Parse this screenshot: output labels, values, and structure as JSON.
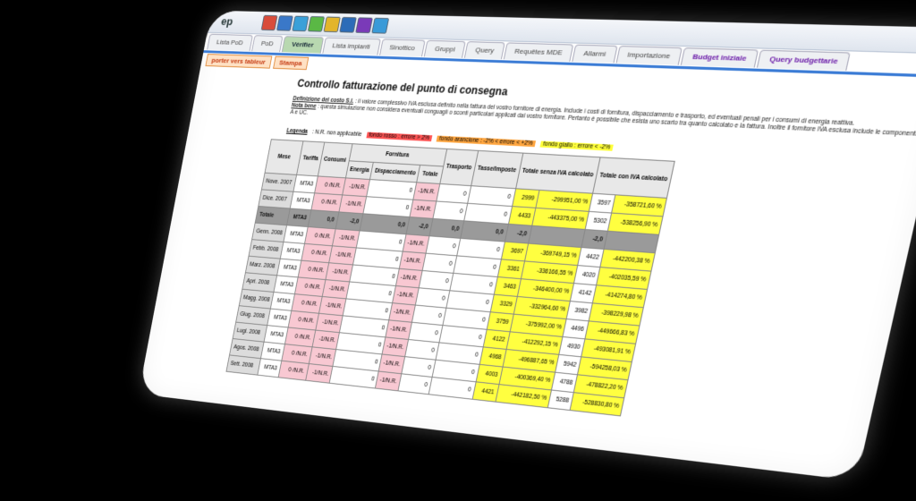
{
  "app": {
    "name": "ep"
  },
  "toolbar_icons": [
    {
      "name": "icon-1",
      "color": "#d94c3a"
    },
    {
      "name": "icon-2",
      "color": "#3a78c8"
    },
    {
      "name": "icon-3",
      "color": "#3aa0d8"
    },
    {
      "name": "icon-4",
      "color": "#5ab845"
    },
    {
      "name": "icon-5",
      "color": "#e3b52a"
    },
    {
      "name": "icon-6",
      "color": "#2c6cb8"
    },
    {
      "name": "icon-7",
      "color": "#7a3ab8"
    },
    {
      "name": "icon-8",
      "color": "#3a9ad8"
    }
  ],
  "tabs": [
    {
      "label": "Lista PoD",
      "style": ""
    },
    {
      "label": "PoD",
      "style": ""
    },
    {
      "label": "Vérifier",
      "style": "active"
    },
    {
      "label": "Lista impianti",
      "style": ""
    },
    {
      "label": "Sinottico",
      "style": ""
    },
    {
      "label": "Gruppi",
      "style": ""
    },
    {
      "label": "Query",
      "style": ""
    },
    {
      "label": "Requêtes MDE",
      "style": ""
    },
    {
      "label": "Allarmi",
      "style": ""
    },
    {
      "label": "Importazione",
      "style": ""
    },
    {
      "label": "Budget iniziale",
      "style": "purple"
    },
    {
      "label": "Query budgettarie",
      "style": "purple"
    }
  ],
  "subtabs": {
    "export": "porter vers tableur",
    "print": "Stampa"
  },
  "page_title": "Controllo fatturazione del punto di consegna",
  "notes": {
    "def_label": "Definizione del costo S.I.",
    "def_text": ": il valore complessivo IVA esclusa definito nella fattura del vostro fornitore di energia. Include i costi di fornitura, dispacciamento e trasporto, ed eventuali penali per i consumi di energia reattiva.",
    "nb_label": "Nota bene",
    "nb_text": ": questa simulazione non considera eventuali conguagli o sconti particolari applicati dal vostro fornitore. Pertanto è possibile che esista uno scarto tra quanto calcolato e la fattura. Inoltre il fornitore IVA esclusa include le componenti A e UC."
  },
  "legend": {
    "label": "Legenda",
    "nr": ": N.R. non applicabile",
    "red": "fondo rosso : errore > 2%",
    "orange": "fondo arancione : -2% < errore < +2%",
    "yellow": "fondo giallo : errore < -2%"
  },
  "table": {
    "headers": {
      "mese": "Mese",
      "tariffa": "Tariffa",
      "consumi": "Consumi",
      "fornitura": "Fornitura",
      "energia": "Energia",
      "dispacciamento": "Dispacciamento",
      "totale": "Totale",
      "trasporto": "Trasporto",
      "tasse": "Tasse/Imposte",
      "senza_iva": "Totale senza IVA calcolato",
      "con_iva": "Totale con IVA calcolato"
    },
    "rows": [
      {
        "mese": "Nove. 2007",
        "tariffa": "MTA3",
        "consumi": "0 /N.R.",
        "energia": "-1/N.R.",
        "disp": "0",
        "totale": "-1/N.R.",
        "trasporto": "0",
        "tasse": "0",
        "senza_iva": "2999",
        "senza_pct": "-299951,00 %",
        "con_iva": "3597",
        "con_pct": "-358721,60 %"
      },
      {
        "mese": "Dice. 2007",
        "tariffa": "MTA3",
        "consumi": "0 /N.R.",
        "energia": "-1/N.R.",
        "disp": "0",
        "totale": "-1/N.R.",
        "trasporto": "0",
        "tasse": "0",
        "senza_iva": "4433",
        "senza_pct": "-443375,00 %",
        "con_iva": "5302",
        "con_pct": "-538256,90 %"
      },
      {
        "mese": "Totale",
        "tariffa": "MTA3",
        "consumi": "0,0",
        "energia": "-2,0",
        "disp": "0,0",
        "totale": "-2,0",
        "trasporto": "0,0",
        "tasse": "0,0",
        "senza_iva": "-2,0",
        "senza_pct": "",
        "con_iva": "-2,0",
        "con_pct": "",
        "total": true
      },
      {
        "mese": "Genn. 2008",
        "tariffa": "MTA3",
        "consumi": "0 /N.R.",
        "energia": "-1/N.R.",
        "disp": "0",
        "totale": "-1/N.R.",
        "trasporto": "0",
        "tasse": "0",
        "senza_iva": "3697",
        "senza_pct": "-369749,15 %",
        "con_iva": "4422",
        "con_pct": "-442200,38 %"
      },
      {
        "mese": "Febb. 2008",
        "tariffa": "MTA3",
        "consumi": "0 /N.R.",
        "energia": "-1/N.R.",
        "disp": "0",
        "totale": "-1/N.R.",
        "trasporto": "0",
        "tasse": "0",
        "senza_iva": "3361",
        "senza_pct": "-336166,55 %",
        "con_iva": "4020",
        "con_pct": "-402035,59 %"
      },
      {
        "mese": "Marz. 2008",
        "tariffa": "MTA3",
        "consumi": "0 /N.R.",
        "energia": "-1/N.R.",
        "disp": "0",
        "totale": "-1/N.R.",
        "trasporto": "0",
        "tasse": "0",
        "senza_iva": "3463",
        "senza_pct": "-346400,00 %",
        "con_iva": "4142",
        "con_pct": "-414274,80 %"
      },
      {
        "mese": "Apri. 2008",
        "tariffa": "MTA3",
        "consumi": "0 /N.R.",
        "energia": "-1/N.R.",
        "disp": "0",
        "totale": "-1/N.R.",
        "trasporto": "0",
        "tasse": "0",
        "senza_iva": "3329",
        "senza_pct": "-332964,60 %",
        "con_iva": "3982",
        "con_pct": "-398229,98 %"
      },
      {
        "mese": "Magg. 2008",
        "tariffa": "MTA3",
        "consumi": "0 /N.R.",
        "energia": "-1/N.R.",
        "disp": "0",
        "totale": "-1/N.R.",
        "trasporto": "0",
        "tasse": "0",
        "senza_iva": "3759",
        "senza_pct": "-375992,00 %",
        "con_iva": "4496",
        "con_pct": "-449666,83 %"
      },
      {
        "mese": "Giug. 2008",
        "tariffa": "MTA3",
        "consumi": "0 /N.R.",
        "energia": "-1/N.R.",
        "disp": "0",
        "totale": "-1/N.R.",
        "trasporto": "0",
        "tasse": "0",
        "senza_iva": "4122",
        "senza_pct": "-412292,15 %",
        "con_iva": "4930",
        "con_pct": "-493081,91 %"
      },
      {
        "mese": "Lugl. 2008",
        "tariffa": "MTA3",
        "consumi": "0 /N.R.",
        "energia": "-1/N.R.",
        "disp": "0",
        "totale": "-1/N.R.",
        "trasporto": "0",
        "tasse": "0",
        "senza_iva": "4968",
        "senza_pct": "-496887,65 %",
        "con_iva": "5942",
        "con_pct": "-594258,03 %"
      },
      {
        "mese": "Agos. 2008",
        "tariffa": "MTA3",
        "consumi": "0 /N.R.",
        "energia": "-1/N.R.",
        "disp": "0",
        "totale": "-1/N.R.",
        "trasporto": "0",
        "tasse": "0",
        "senza_iva": "4003",
        "senza_pct": "-400369,40 %",
        "con_iva": "4788",
        "con_pct": "-478822,20 %"
      },
      {
        "mese": "Sett. 2008",
        "tariffa": "MTA3",
        "consumi": "0 /N.R.",
        "energia": "-1/N.R.",
        "disp": "0",
        "totale": "-1/N.R.",
        "trasporto": "0",
        "tasse": "0",
        "senza_iva": "4421",
        "senza_pct": "-442182,50 %",
        "con_iva": "5288",
        "con_pct": "-528830,80 %"
      }
    ]
  }
}
